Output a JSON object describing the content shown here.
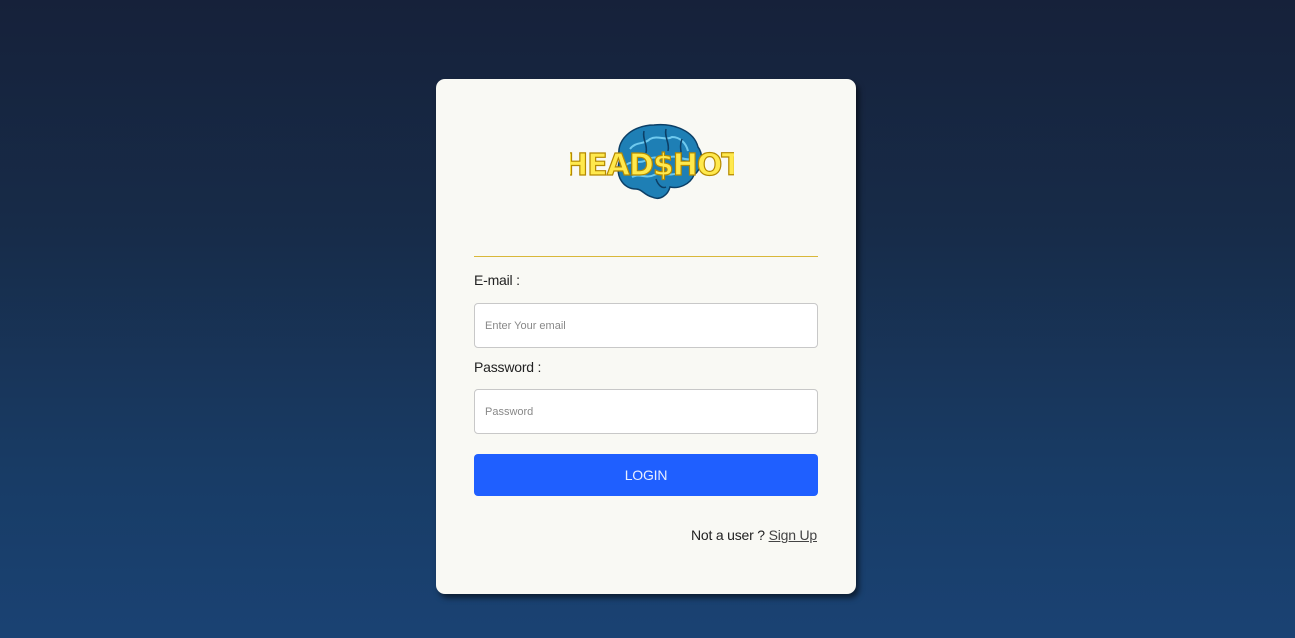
{
  "login_card": {
    "brand_name": "HEAD$HOT",
    "email_label": "E-mail :",
    "email_placeholder": "Enter Your email",
    "email_value": "",
    "password_label": "Password :",
    "password_placeholder": "Password",
    "password_value": "",
    "login_label": "LOGIN",
    "signup_prompt": "Not a user ?",
    "signup_link": "Sign Up"
  },
  "colors": {
    "accent": "#1f5fff",
    "divider": "#d9b83a",
    "card_bg": "#f9f9f4",
    "logo_text": "#ffe94d",
    "logo_brain": "#1e7fb5"
  },
  "icons": {
    "logo": "brain-logo-icon"
  }
}
